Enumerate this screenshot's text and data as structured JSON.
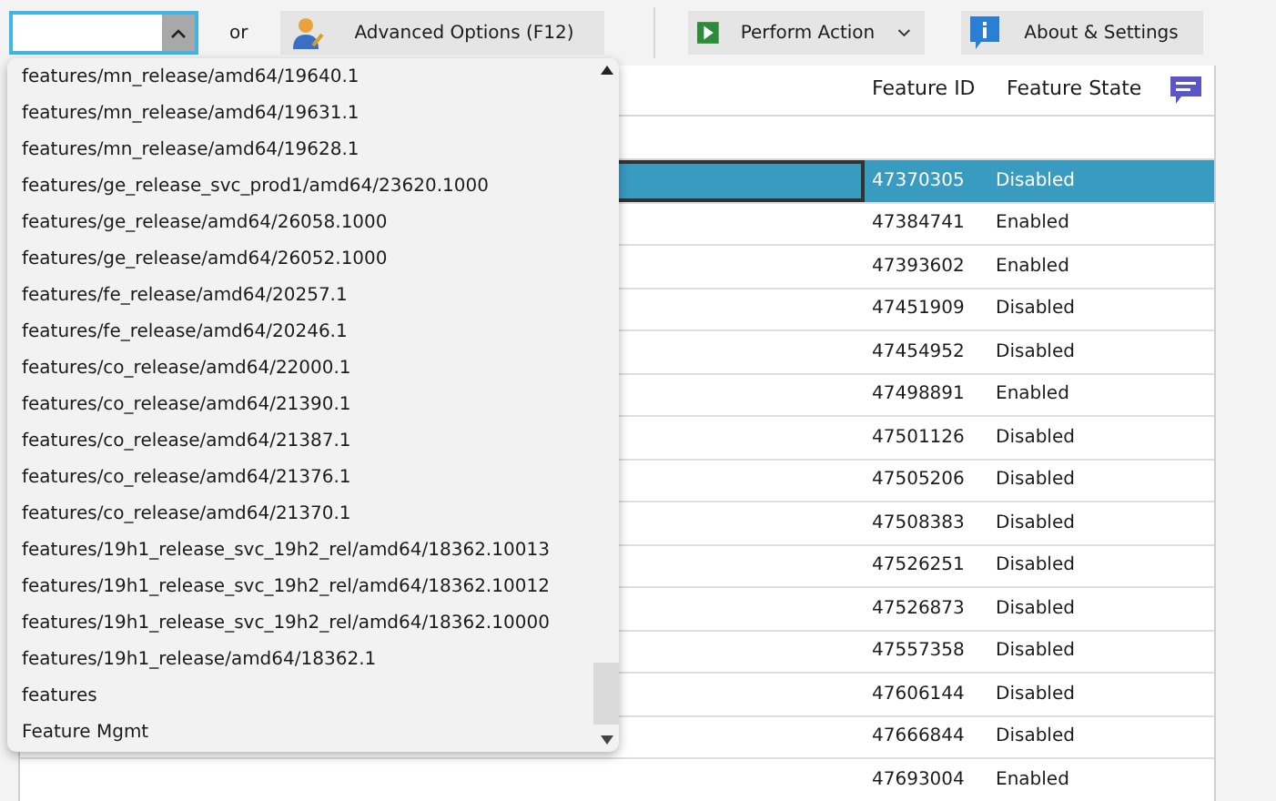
{
  "toolbar": {
    "separator_text": "or",
    "advanced_button": "Advanced Options (F12)",
    "perform_button": "Perform Action",
    "about_button": "About & Settings"
  },
  "dropdown": {
    "items": [
      "features/mn_release/amd64/19640.1",
      "features/mn_release/amd64/19631.1",
      "features/mn_release/amd64/19628.1",
      "features/ge_release_svc_prod1/amd64/23620.1000",
      "features/ge_release/amd64/26058.1000",
      "features/ge_release/amd64/26052.1000",
      "features/fe_release/amd64/20257.1",
      "features/fe_release/amd64/20246.1",
      "features/co_release/amd64/22000.1",
      "features/co_release/amd64/21390.1",
      "features/co_release/amd64/21387.1",
      "features/co_release/amd64/21376.1",
      "features/co_release/amd64/21370.1",
      "features/19h1_release_svc_19h2_rel/amd64/18362.10013",
      "features/19h1_release_svc_19h2_rel/amd64/18362.10012",
      "features/19h1_release_svc_19h2_rel/amd64/18362.10000",
      "features/19h1_release/amd64/18362.1",
      "features",
      "Feature Mgmt"
    ]
  },
  "table": {
    "columns": [
      "Feature ID",
      "Feature State"
    ],
    "rows": [
      {
        "feature_id": "47370305",
        "state": "Disabled",
        "selected": true
      },
      {
        "feature_id": "47384741",
        "state": "Enabled",
        "selected": false
      },
      {
        "feature_id": "47393602",
        "state": "Enabled",
        "selected": false
      },
      {
        "feature_id": "47451909",
        "state": "Disabled",
        "selected": false
      },
      {
        "feature_id": "47454952",
        "state": "Disabled",
        "selected": false
      },
      {
        "feature_id": "47498891",
        "state": "Enabled",
        "selected": false
      },
      {
        "feature_id": "47501126",
        "state": "Disabled",
        "selected": false
      },
      {
        "feature_id": "47505206",
        "state": "Disabled",
        "selected": false
      },
      {
        "feature_id": "47508383",
        "state": "Disabled",
        "selected": false
      },
      {
        "feature_id": "47526251",
        "state": "Disabled",
        "selected": false
      },
      {
        "feature_id": "47526873",
        "state": "Disabled",
        "selected": false
      },
      {
        "feature_id": "47557358",
        "state": "Disabled",
        "selected": false
      },
      {
        "feature_id": "47606144",
        "state": "Disabled",
        "selected": false
      },
      {
        "feature_id": "47666844",
        "state": "Disabled",
        "selected": false
      },
      {
        "feature_id": "47693004",
        "state": "Enabled",
        "selected": false
      }
    ]
  }
}
